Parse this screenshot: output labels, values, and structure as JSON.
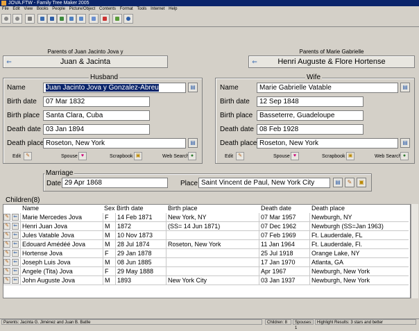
{
  "window": {
    "title": "JOVA.FTW - Family Tree Maker 2005"
  },
  "menu": [
    "File",
    "Edit",
    "View",
    "Books",
    "People",
    "Picture/Object",
    "Contents",
    "Format",
    "Tools",
    "Internet",
    "Help"
  ],
  "husband_parents": {
    "label": "Parents of Juan Jacinto Jova y",
    "button": "Juan & Jacinta"
  },
  "wife_parents": {
    "label": "Parents of Marie Gabrielle",
    "button": "Henri Auguste & Flore Hortense"
  },
  "husband": {
    "title": "Husband",
    "labels": {
      "name": "Name",
      "birth_date": "Birth date",
      "birth_place": "Birth place",
      "death_date": "Death date",
      "death_place": "Death place"
    },
    "name": "Juan Jacinto Jova y Gonzalez-Abreu",
    "birth_date": "07 Mar 1832",
    "birth_place": "Santa Clara, Cuba",
    "death_date": "03 Jan 1894",
    "death_place": "Roseton, New York",
    "actions": {
      "edit": "Edit",
      "spouse": "Spouse",
      "scrapbook": "Scrapbook",
      "web_search": "Web Search"
    }
  },
  "wife": {
    "title": "Wife",
    "labels": {
      "name": "Name",
      "birth_date": "Birth date",
      "birth_place": "Birth place",
      "death_date": "Death date",
      "death_place": "Death place"
    },
    "name": "Marie Gabrielle Vatable",
    "birth_date": "12 Sep 1848",
    "birth_place": "Basseterre, Guadeloupe",
    "death_date": "08 Feb 1928",
    "death_place": "Roseton, New York",
    "actions": {
      "edit": "Edit",
      "spouse": "Spouse",
      "scrapbook": "Scrapbook",
      "web_search": "Web Search"
    }
  },
  "marriage": {
    "title": "Marriage",
    "date_label": "Date",
    "date": "29 Apr 1868",
    "place_label": "Place",
    "place": "Saint Vincent de Paul, New York City"
  },
  "children": {
    "title": "Children(8)",
    "headers": {
      "name": "Name",
      "sex": "Sex",
      "birth_date": "Birth date",
      "birth_place": "Birth place",
      "death_date": "Death date",
      "death_place": "Death place"
    },
    "rows": [
      {
        "name": "Marie Mercedes Jova",
        "sex": "F",
        "birth_date": "14 Feb 1871",
        "birth_place": "New York, NY",
        "death_date": "07 Mar 1957",
        "death_place": "Newburgh, NY"
      },
      {
        "name": "Henri Juan Jova",
        "sex": "M",
        "birth_date": "1872",
        "birth_place": "(SS= 14 Jun 1871)",
        "death_date": "07 Dec 1962",
        "death_place": "Newburgh (SS=Jan 1963)"
      },
      {
        "name": "Jules Vatable Jova",
        "sex": "M",
        "birth_date": "10 Nov 1873",
        "birth_place": "",
        "death_date": "07 Feb 1969",
        "death_place": "Ft. Lauderdale, FL"
      },
      {
        "name": "Edouard Amédéé Jova",
        "sex": "M",
        "birth_date": "28 Jul 1874",
        "birth_place": "Roseton, New York",
        "death_date": "11 Jan 1964",
        "death_place": "Ft. Lauderdale, Fl."
      },
      {
        "name": "Hortense Jova",
        "sex": "F",
        "birth_date": "29 Jan 1878",
        "birth_place": "",
        "death_date": "25 Jul 1918",
        "death_place": "Orange Lake, NY"
      },
      {
        "name": "Joseph Luis Jova",
        "sex": "M",
        "birth_date": "08 Jun 1885",
        "birth_place": "",
        "death_date": "17 Jan 1970",
        "death_place": "Atlanta, GA"
      },
      {
        "name": "Angele (Tita) Jova",
        "sex": "F",
        "birth_date": "29 May 1888",
        "birth_place": "",
        "death_date": "Apr 1967",
        "death_place": "Newburgh, New York"
      },
      {
        "name": "John Auguste Jova",
        "sex": "M",
        "birth_date": "1893",
        "birth_place": "New York City",
        "death_date": "03 Jan 1937",
        "death_place": "Newburgh, New York"
      }
    ]
  },
  "status": {
    "parents": "Parents: Jacinta G. Jiménez and Juan B. Batlle",
    "children": "Children: 8",
    "spouses": "Spouses: 1",
    "highlight": "Highlight Results: 3 stars and better"
  },
  "colors": {
    "selection": "#0a246a",
    "window_bg": "#d4d0c8",
    "title_bar": "#0a246a"
  }
}
